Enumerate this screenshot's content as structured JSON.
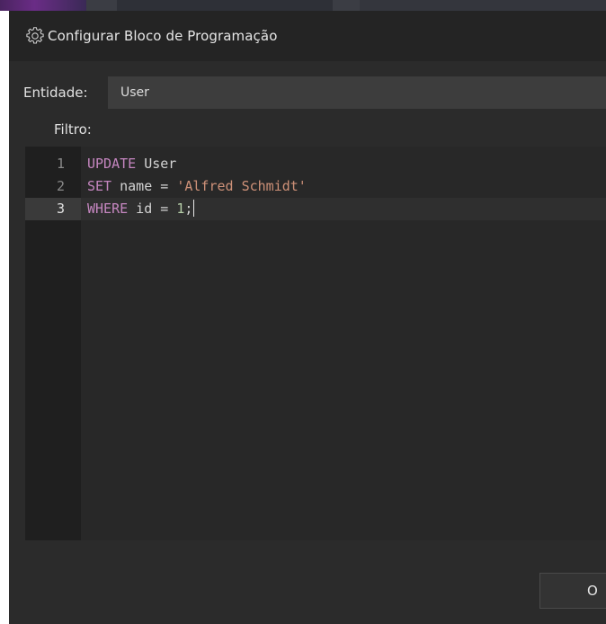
{
  "dialog": {
    "title": "Configurar Bloco de Programação",
    "title_icon": "gear-icon"
  },
  "entity": {
    "label": "Entidade:",
    "value": "User"
  },
  "filter": {
    "label": "Filtro:"
  },
  "editor": {
    "active_line": 3,
    "lines": [
      {
        "number": "1",
        "tokens": [
          {
            "t": "UPDATE",
            "k": "kw"
          },
          {
            "t": " User",
            "k": "ident"
          }
        ]
      },
      {
        "number": "2",
        "tokens": [
          {
            "t": "SET",
            "k": "kw"
          },
          {
            "t": " name ",
            "k": "ident"
          },
          {
            "t": "=",
            "k": "op"
          },
          {
            "t": " ",
            "k": "ident"
          },
          {
            "t": "'Alfred Schmidt'",
            "k": "str"
          }
        ]
      },
      {
        "number": "3",
        "tokens": [
          {
            "t": "WHERE",
            "k": "kw"
          },
          {
            "t": " id ",
            "k": "ident"
          },
          {
            "t": "=",
            "k": "op"
          },
          {
            "t": " ",
            "k": "ident"
          },
          {
            "t": "1",
            "k": "num"
          },
          {
            "t": ";",
            "k": "punct"
          }
        ]
      }
    ]
  },
  "footer": {
    "ok_label": "O"
  },
  "colors": {
    "keyword": "#c586c0",
    "string": "#ce9178",
    "number": "#b5cea8",
    "background": "#2b2b2b"
  }
}
